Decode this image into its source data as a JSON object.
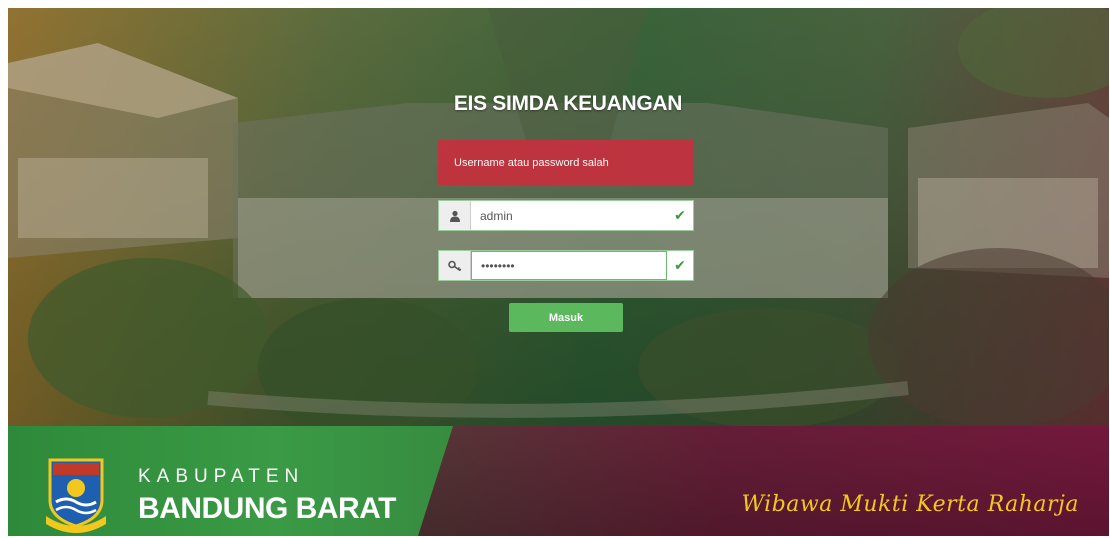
{
  "login": {
    "title": "EIS SIMDA KEUANGAN",
    "error_message": "Username atau password salah",
    "username": {
      "value": "admin",
      "icon": "user-icon"
    },
    "password": {
      "value": "••••••••",
      "icon": "key-icon"
    },
    "submit_label": "Masuk",
    "valid_mark": "✔"
  },
  "banner": {
    "region_word": "KABUPATEN",
    "region_name": "BANDUNG BARAT",
    "motto": "Wibawa Mukti Kerta Raharja",
    "emblem": "kabupaten-bandung-barat-emblem"
  },
  "colors": {
    "alert": "#c2323f",
    "button": "#5cb85c",
    "banner_green": "#3a9a45",
    "banner_maroon": "#7a1a3f",
    "motto": "#f2c81e"
  }
}
